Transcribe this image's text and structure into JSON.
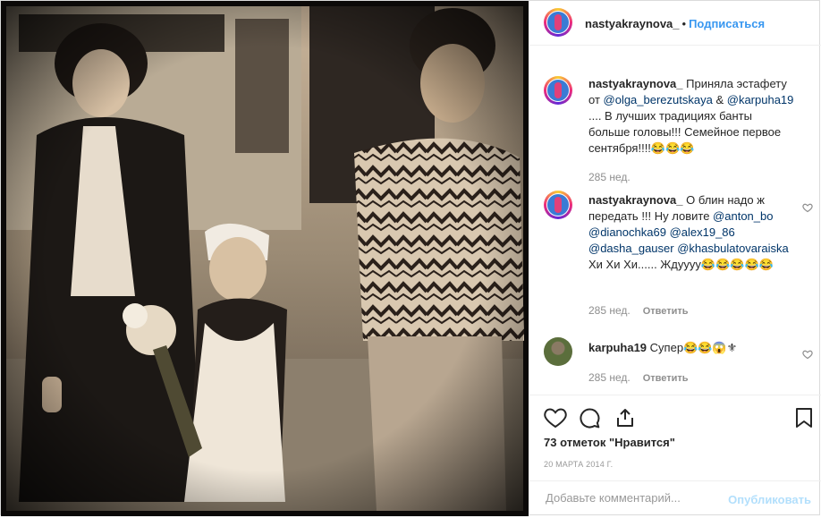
{
  "post": {
    "author": "nastyakraynova_",
    "separator": "•",
    "follow_label": "Подписаться"
  },
  "comments": [
    {
      "user": "nastyakraynova_",
      "parts": [
        " Приняла эстафету от ",
        "@olga_berezutskaya",
        " & ",
        "@karpuha19",
        " .... В лучших традициях банты больше головы!!! Семейное первое сентября!!!!😂😂😂"
      ],
      "time": "285 нед.",
      "reply": ""
    },
    {
      "user": "nastyakraynova_",
      "parts": [
        " О блин надо ж передать !!! Ну ловите ",
        "@anton_bo",
        " ",
        "@dianochka69",
        " ",
        "@alex19_86",
        " ",
        "@dasha_gauser",
        " ",
        "@khasbulatovaraiska",
        " Хи Хи Хи...... Жду",
        "ууу😂😂😂😂😂"
      ],
      "time": "285 нед.",
      "reply": "Ответить"
    },
    {
      "user": "karpuha19",
      "parts": [
        " Супер😂😂😱⚜"
      ],
      "time": "285 нед.",
      "reply": "Ответить"
    }
  ],
  "actions": {
    "likes_text": "73 отметок \"Нравится\"",
    "date": "20 МАРТА 2014 Г."
  },
  "add_comment": {
    "placeholder": "Добавьте комментарий...",
    "publish_label": "Опубликовать"
  },
  "colors": {
    "link": "#003569",
    "follow": "#3897f0",
    "muted": "#8e8e8e",
    "publish_disabled": "#b2dffc"
  },
  "icons": [
    "heart-icon",
    "comment-icon",
    "share-icon",
    "bookmark-icon",
    "small-heart-icon"
  ]
}
